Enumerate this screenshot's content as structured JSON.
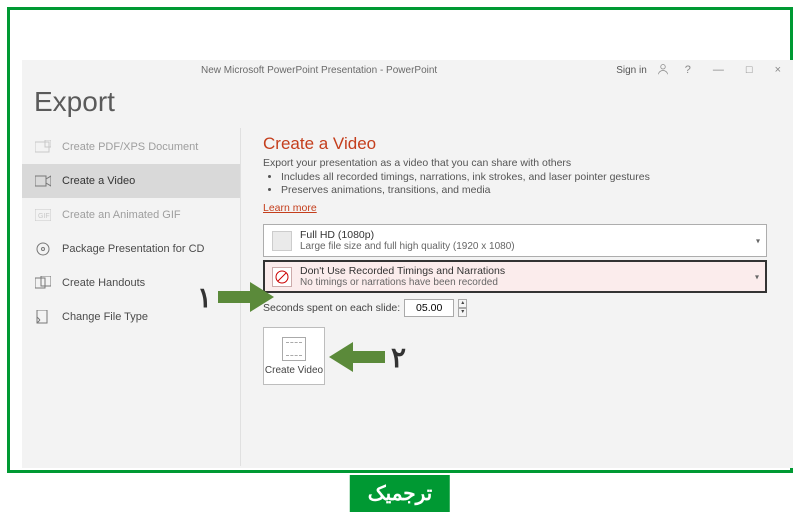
{
  "titlebar": {
    "doc_title": "New Microsoft PowerPoint Presentation  -  PowerPoint",
    "signin": "Sign in"
  },
  "page_title": "Export",
  "sidebar": {
    "items": [
      {
        "label": "Create PDF/XPS Document"
      },
      {
        "label": "Create a Video"
      },
      {
        "label": "Create an Animated GIF"
      },
      {
        "label": "Package Presentation for CD"
      },
      {
        "label": "Create Handouts"
      },
      {
        "label": "Change File Type"
      }
    ]
  },
  "pane": {
    "heading": "Create a Video",
    "subtitle": "Export your presentation as a video that you can share with others",
    "features": [
      "Includes all recorded timings, narrations, ink strokes, and laser pointer gestures",
      "Preserves animations, transitions, and media"
    ],
    "learn_more": "Learn more",
    "quality": {
      "line1": "Full HD (1080p)",
      "line2": "Large file size and full high quality (1920 x 1080)"
    },
    "timings": {
      "line1": "Don't Use Recorded Timings and Narrations",
      "line2": "No timings or narrations have been recorded"
    },
    "seconds_label": "Seconds spent on each slide:",
    "seconds_value": "05.00",
    "create_button": "Create Video"
  },
  "annotations": {
    "arrow1_num": "١",
    "arrow2_num": "٢"
  },
  "footer_brand": "ترجمیک"
}
